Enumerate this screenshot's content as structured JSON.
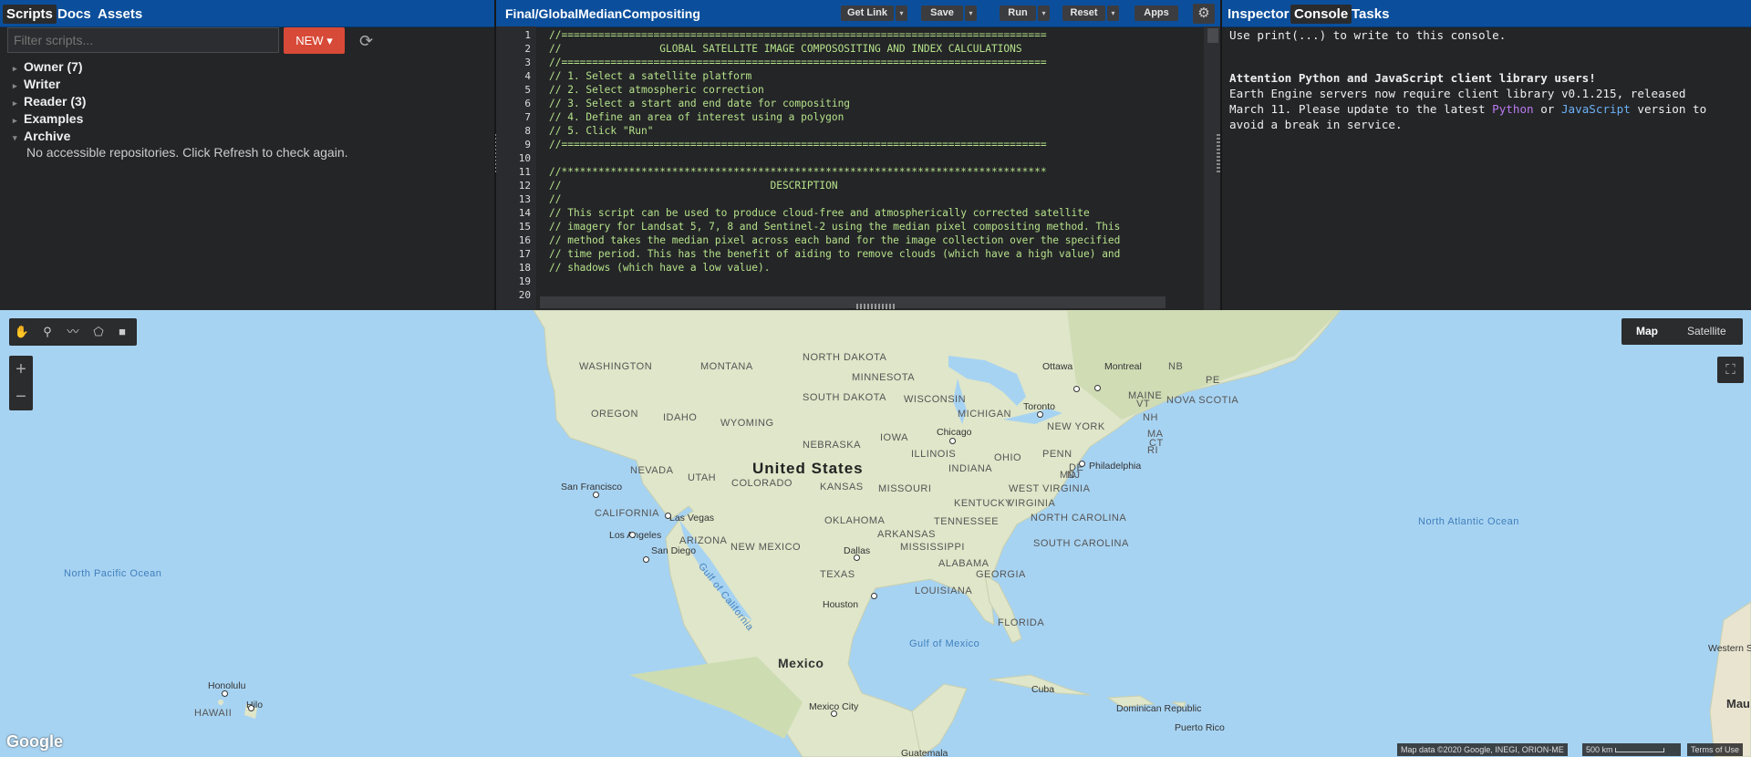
{
  "left_panel": {
    "tabs": [
      "Scripts",
      "Docs",
      "Assets"
    ],
    "filter_placeholder": "Filter scripts...",
    "new_button": "NEW",
    "tree": [
      "Owner (7)",
      "Writer",
      "Reader (3)",
      "Examples",
      "Archive"
    ],
    "archive_message": "No accessible repositories. Click Refresh to check again."
  },
  "editor": {
    "title": "Final/GlobalMedianCompositing",
    "buttons": [
      "Get Link",
      "Save",
      "Run",
      "Reset",
      "Apps"
    ],
    "line_numbers": [
      "1",
      "2",
      "3",
      "4",
      "5",
      "6",
      "7",
      "8",
      "9",
      "10",
      "11",
      "12",
      "13",
      "14",
      "15",
      "16",
      "17",
      "18",
      "19",
      "20"
    ],
    "lines": [
      "//===============================================================================",
      "//                GLOBAL SATELLITE IMAGE COMPOSOSITING AND INDEX CALCULATIONS",
      "//===============================================================================",
      "// 1. Select a satellite platform",
      "// 2. Select atmospheric correction",
      "// 3. Select a start and end date for compositing",
      "// 4. Define an area of interest using a polygon",
      "// 5. Click \"Run\"",
      "//===============================================================================",
      "",
      "//*******************************************************************************",
      "//                                  DESCRIPTION",
      "//",
      "// This script can be used to produce cloud-free and atmospherically corrected satellite",
      "// imagery for Landsat 5, 7, 8 and Sentinel-2 using the median pixel compositing method. This",
      "// method takes the median pixel across each band for the image collection over the specified",
      "// time period. This has the benefit of aiding to remove clouds (which have a high value) and",
      "// shadows (which have a low value).",
      "",
      ""
    ]
  },
  "console": {
    "tabs": [
      "Inspector",
      "Console",
      "Tasks"
    ],
    "line1": "Use print(...) to write to this console.",
    "attention": "Attention Python and JavaScript client library users!",
    "msg_a": "Earth Engine servers now require client library v0.1.215, released",
    "msg_b": "March 11. Please update to the latest ",
    "python": "Python",
    "or": " or ",
    "javascript": "JavaScript",
    "msg_c": " version to",
    "msg_d": "avoid a break in service."
  },
  "map": {
    "map_type": [
      "Map",
      "Satellite"
    ],
    "country": "United States",
    "mexico": "Mexico",
    "states": [
      "WASHINGTON",
      "MONTANA",
      "NORTH DAKOTA",
      "MINNESOTA",
      "OREGON",
      "IDAHO",
      "SOUTH DAKOTA",
      "WISCONSIN",
      "WYOMING",
      "MICHIGAN",
      "IOWA",
      "NEBRASKA",
      "NEVADA",
      "UTAH",
      "ILLINOIS",
      "INDIANA",
      "OHIO",
      "PENN",
      "COLORADO",
      "KANSAS",
      "MISSOURI",
      "CALIFORNIA",
      "OKLAHOMA",
      "ARKANSAS",
      "TENNESSEE",
      "KENTUCKY",
      "ARIZONA",
      "NEW MEXICO",
      "TEXAS",
      "MISSISSIPPI",
      "ALABAMA",
      "GEORGIA",
      "LOUISIANA",
      "FLORIDA",
      "WEST VIRGINIA",
      "VIRGINIA",
      "NORTH CAROLINA",
      "SOUTH CAROLINA",
      "NEW YORK",
      "MAINE",
      "NB",
      "PE",
      "NOVA SCOTIA",
      "VT",
      "NH",
      "MA",
      "CT",
      "RI",
      "NJ",
      "MD",
      "DE",
      "HAWAII"
    ],
    "cities": [
      "Ottawa",
      "Montreal",
      "Toronto",
      "Chicago",
      "Philadelphia",
      "San Francisco",
      "Las Vegas",
      "Los Angeles",
      "San Diego",
      "Dallas",
      "Houston",
      "Mexico City",
      "Honolulu",
      "Hilo",
      "Cuba",
      "Dominican Republic",
      "Puerto Rico",
      "Guatemala"
    ],
    "oceans": [
      "North Pacific Ocean",
      "North Atlantic Ocean",
      "Gulf of Mexico",
      "Gulf of California"
    ],
    "extra": [
      "Western Sahara",
      "Mau"
    ],
    "attribution": "Map data ©2020 Google, INEGI, ORION-ME",
    "scale": "500 km",
    "terms": "Terms of Use",
    "google": "Google"
  }
}
